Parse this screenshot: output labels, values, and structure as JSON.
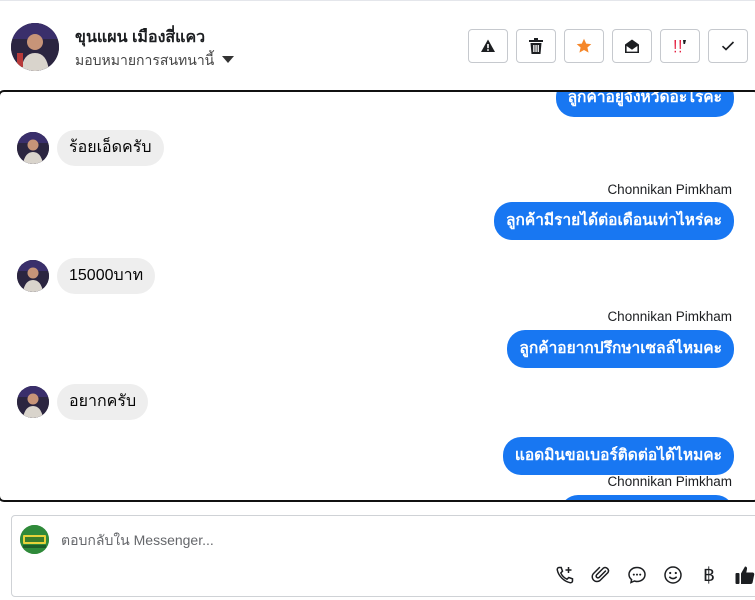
{
  "header": {
    "contact_name": "ขุนแผน เมืองสี่แคว",
    "assign_label": "มอบหมายการสนทนานี้",
    "actions": [
      {
        "name": "report-spam-button",
        "icon": "warning-icon"
      },
      {
        "name": "delete-button",
        "icon": "trash-icon"
      },
      {
        "name": "star-button",
        "icon": "star-icon",
        "color": "#f5872a"
      },
      {
        "name": "mark-unread-button",
        "icon": "envelope-open-icon"
      },
      {
        "name": "follow-up-button",
        "icon": "follow-up-icon",
        "color": "#e41e3f"
      },
      {
        "name": "mark-done-button",
        "icon": "check-icon"
      }
    ]
  },
  "conversation": {
    "messages": [
      {
        "direction": "out",
        "text": "ลูกค้าอยู่จังหวัดอะไรคะ"
      },
      {
        "direction": "in",
        "text": "ร้อยเอ็ดครับ"
      },
      {
        "direction": "out",
        "sender": "Chonnikan Pimkham",
        "text": "ลูกค้ามีรายได้ต่อเดือนเท่าไหร่คะ"
      },
      {
        "direction": "in",
        "text": "15000บาท"
      },
      {
        "direction": "out",
        "sender": "Chonnikan Pimkham",
        "text": "ลูกค้าอยากปรึกษาเซลล์ไหมคะ"
      },
      {
        "direction": "in",
        "text": "อยากครับ"
      },
      {
        "direction": "out",
        "text": "แอดมินขอเบอร์ติดต่อได้ไหมคะ"
      },
      {
        "direction": "out",
        "sender": "Chonnikan Pimkham",
        "text": ""
      }
    ]
  },
  "composer": {
    "placeholder": "ตอบกลับใน Messenger...",
    "value": "",
    "tools": [
      "call-add-icon",
      "paperclip-icon",
      "chat-bubble-icon",
      "emoji-icon",
      "baht-icon",
      "thumbs-up-icon"
    ]
  },
  "colors": {
    "outgoing_bubble": "#1877f2",
    "incoming_bubble": "#eeeeee",
    "star": "#f5872a",
    "follow_up": "#e41e3f"
  }
}
